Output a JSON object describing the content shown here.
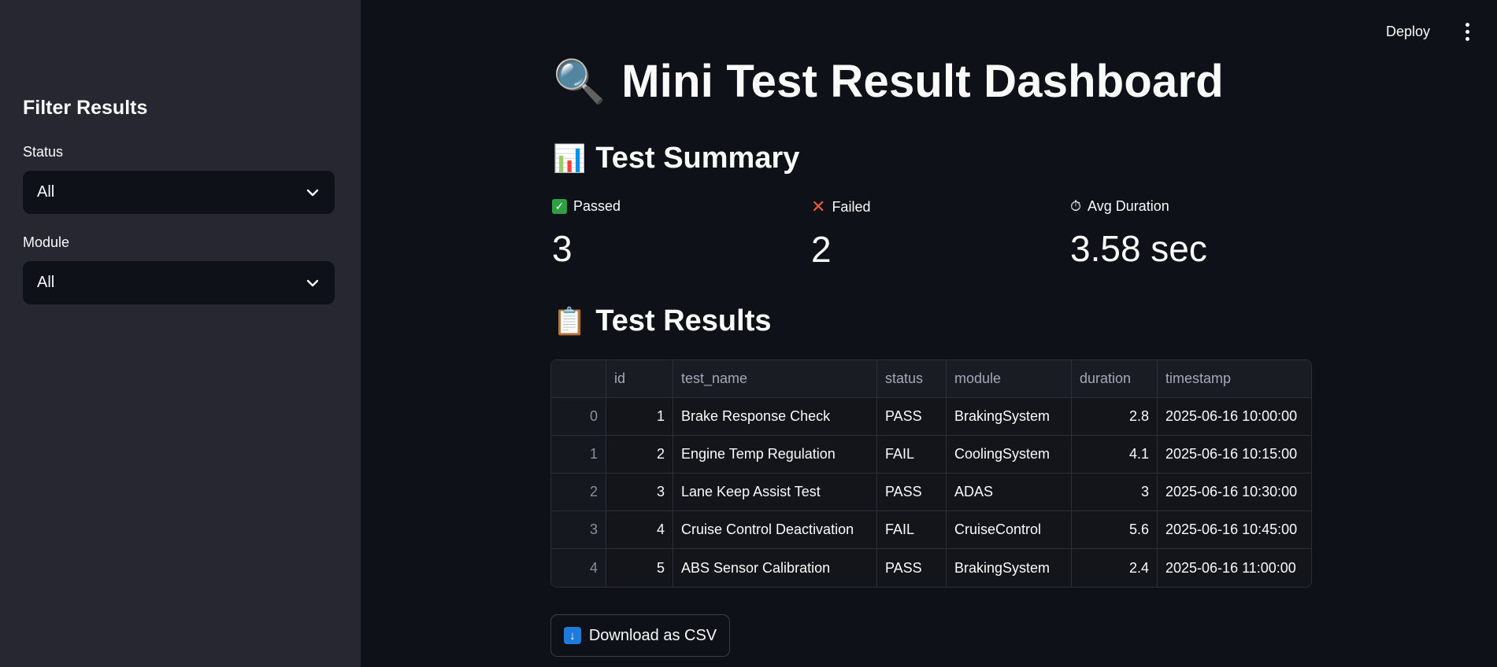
{
  "sidebar": {
    "title": "Filter Results",
    "filters": [
      {
        "label": "Status",
        "value": "All"
      },
      {
        "label": "Module",
        "value": "All"
      }
    ]
  },
  "topbar": {
    "deploy_label": "Deploy"
  },
  "page": {
    "title": "Mini Test Result Dashboard",
    "title_icon": "🔍"
  },
  "summary": {
    "heading": "Test Summary",
    "heading_icon": "📊",
    "metrics": [
      {
        "label": "Passed",
        "value": "3",
        "icon": "check-icon"
      },
      {
        "label": "Failed",
        "value": "2",
        "icon": "x-icon"
      },
      {
        "label": "Avg Duration",
        "value": "3.58 sec",
        "icon": "stopwatch-icon"
      }
    ]
  },
  "results": {
    "heading": "Test Results",
    "heading_icon": "📋",
    "columns": [
      "id",
      "test_name",
      "status",
      "module",
      "duration",
      "timestamp"
    ],
    "rows": [
      {
        "idx": "0",
        "id": "1",
        "test_name": "Brake Response Check",
        "status": "PASS",
        "module": "BrakingSystem",
        "duration": "2.8",
        "timestamp": "2025-06-16 10:00:00"
      },
      {
        "idx": "1",
        "id": "2",
        "test_name": "Engine Temp Regulation",
        "status": "FAIL",
        "module": "CoolingSystem",
        "duration": "4.1",
        "timestamp": "2025-06-16 10:15:00"
      },
      {
        "idx": "2",
        "id": "3",
        "test_name": "Lane Keep Assist Test",
        "status": "PASS",
        "module": "ADAS",
        "duration": "3",
        "timestamp": "2025-06-16 10:30:00"
      },
      {
        "idx": "3",
        "id": "4",
        "test_name": "Cruise Control Deactivation",
        "status": "FAIL",
        "module": "CruiseControl",
        "duration": "5.6",
        "timestamp": "2025-06-16 10:45:00"
      },
      {
        "idx": "4",
        "id": "5",
        "test_name": "ABS Sensor Calibration",
        "status": "PASS",
        "module": "BrakingSystem",
        "duration": "2.4",
        "timestamp": "2025-06-16 11:00:00"
      }
    ]
  },
  "download": {
    "label": "Download as CSV",
    "icon": "download-icon"
  }
}
